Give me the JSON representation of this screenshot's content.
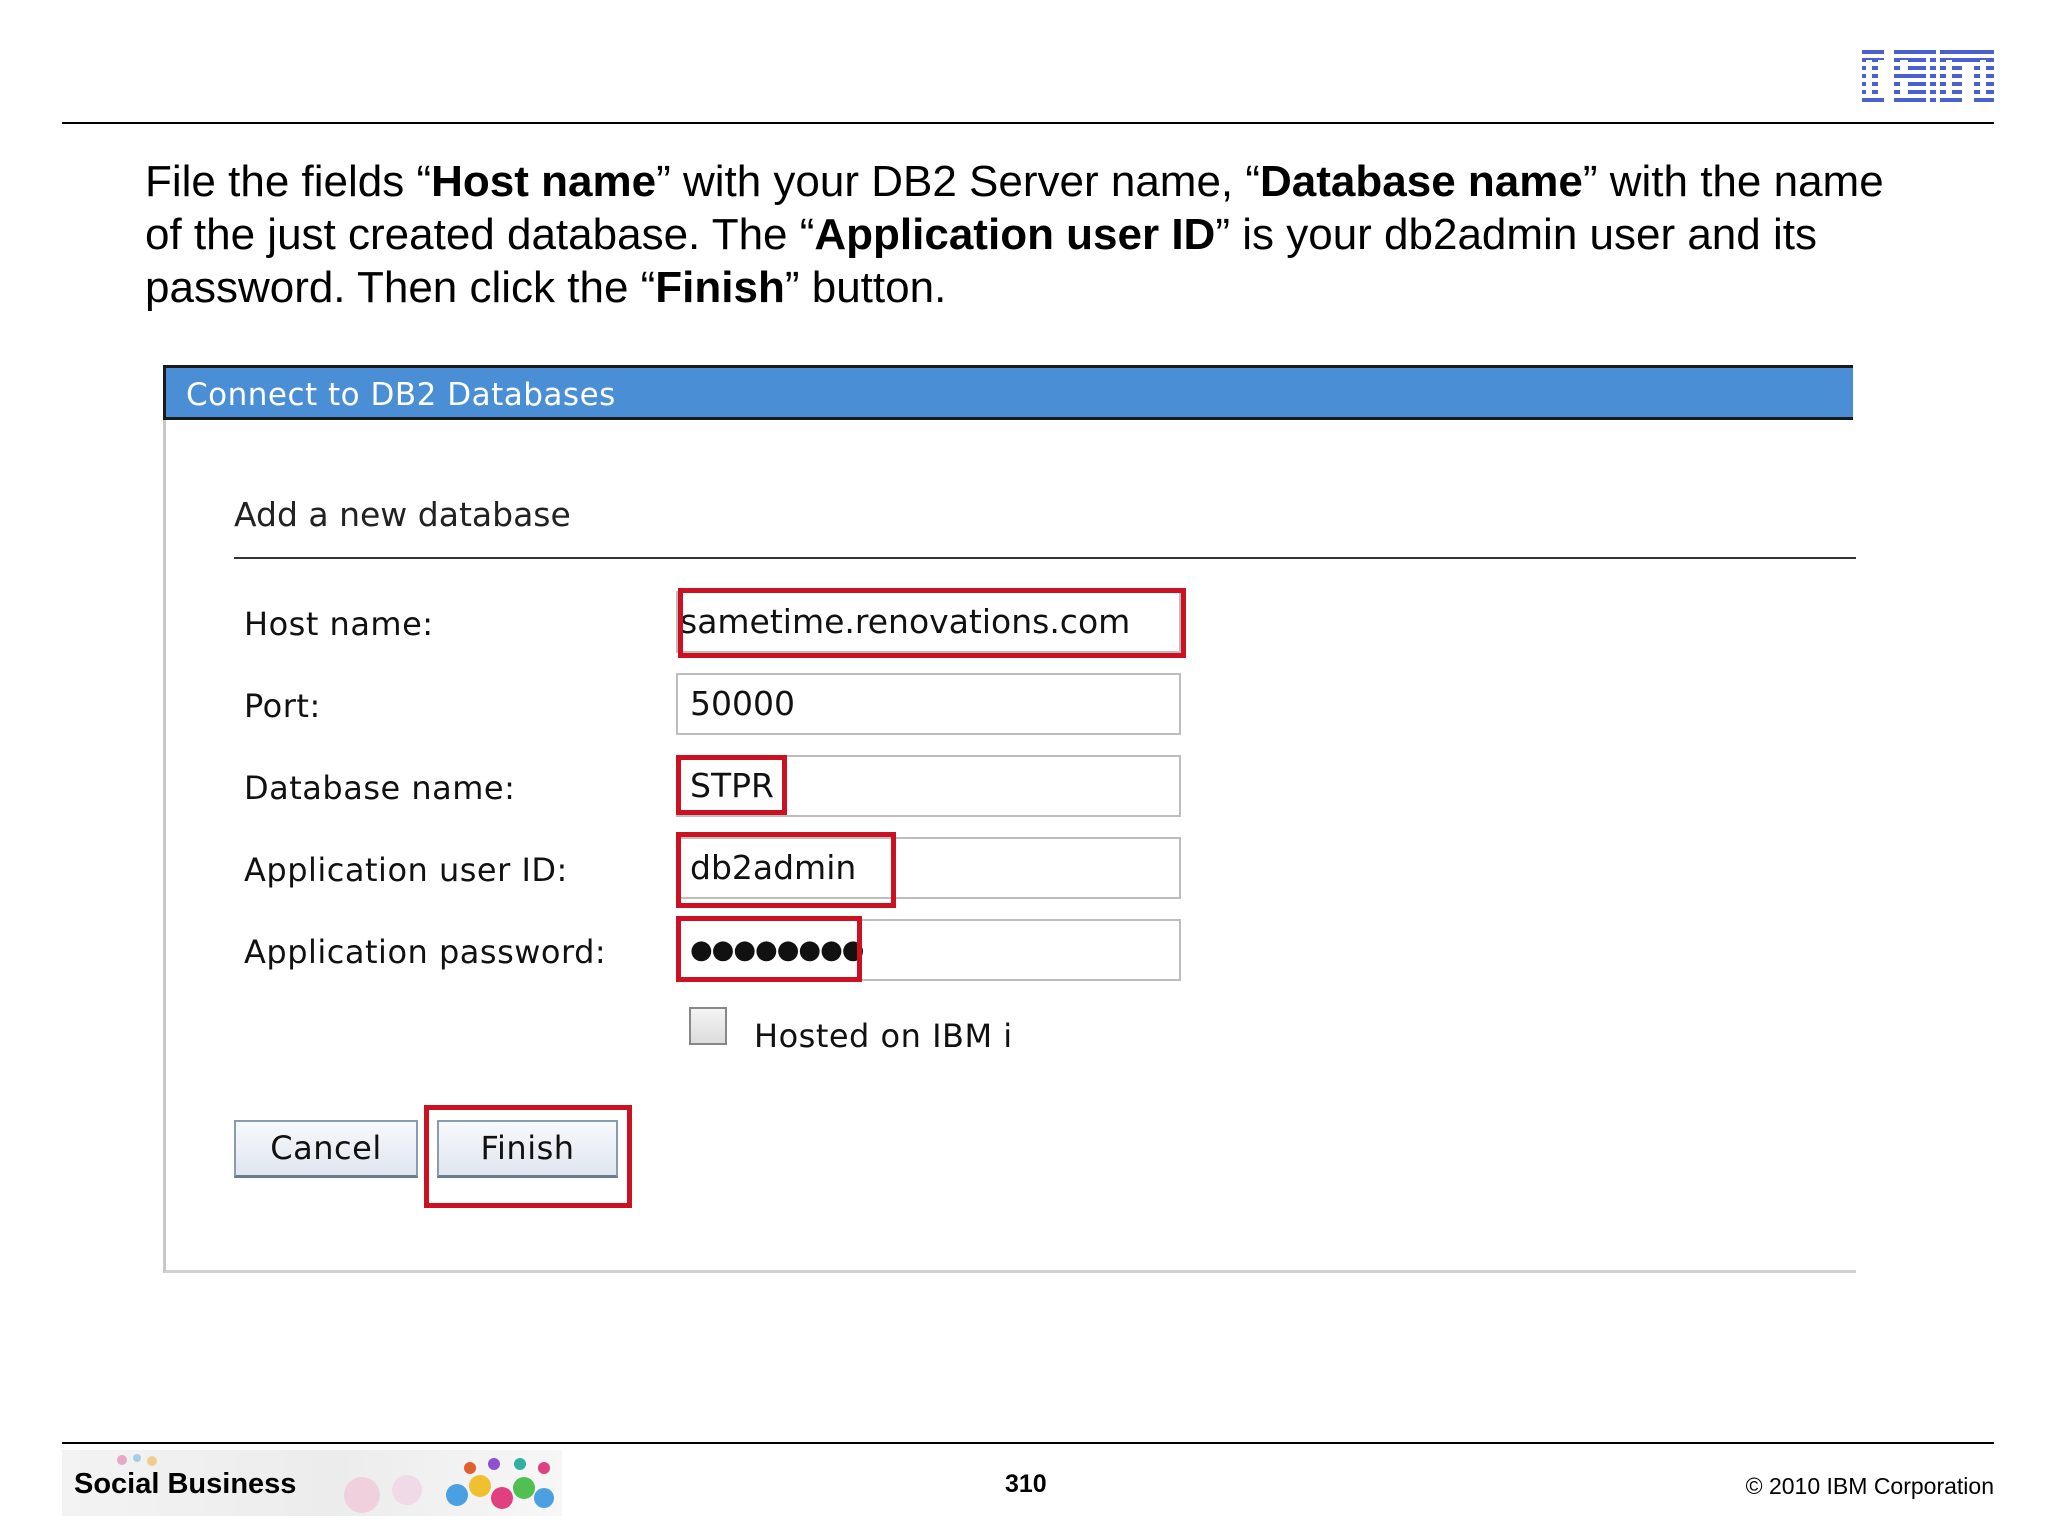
{
  "brand": {
    "logo_text": "IBM",
    "logo_color": "#4a5fd0"
  },
  "instructions": {
    "p1": "File the fields “",
    "b1": "Host name",
    "p2": "” with your DB2 Server name, “",
    "b2": "Database name",
    "p3": "” with the name of the just created database. The “",
    "b3": "Application user ID",
    "p4": "” is your db2admin user and its password. Then click the “",
    "b4": "Finish",
    "p5": "” button."
  },
  "dialog": {
    "title": "Connect to DB2 Databases",
    "title_bar_color": "#4a8fd6",
    "section_heading": "Add a new database",
    "fields": [
      {
        "label": "Host name:",
        "value": "sametime.renovations.com"
      },
      {
        "label": "Port:",
        "value": "50000"
      },
      {
        "label": "Database name:",
        "value": "STPR"
      },
      {
        "label": "Application user ID:",
        "value": "db2admin"
      },
      {
        "label": "Application password:",
        "value": "●●●●●●●●"
      }
    ],
    "checkbox": {
      "label": "Hosted on IBM i",
      "checked": false
    },
    "buttons": {
      "cancel": "Cancel",
      "finish": "Finish"
    },
    "highlight_color": "#cc1122"
  },
  "footer": {
    "banner_text": "Social Business",
    "page_number": "310",
    "copyright": "© 2010 IBM Corporation"
  }
}
